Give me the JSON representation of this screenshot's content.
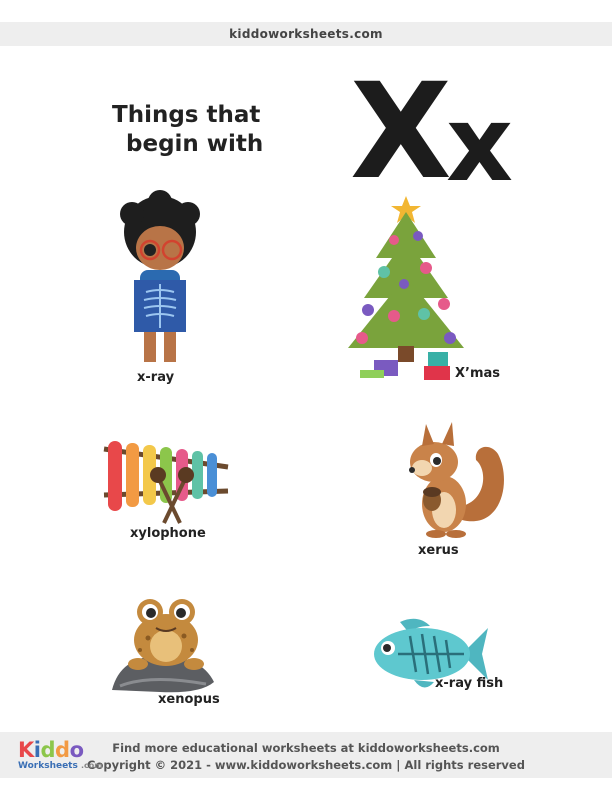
{
  "header": {
    "site": "kiddoworksheets.com"
  },
  "title": {
    "line1": "Things that",
    "line2": "begin with",
    "upper": "X",
    "lower": "x"
  },
  "items": [
    {
      "label": "x-ray",
      "icon": "boy-holding-x-ray-icon"
    },
    {
      "label": "X’mas",
      "icon": "christmas-tree-icon"
    },
    {
      "label": "xylophone",
      "icon": "xylophone-icon"
    },
    {
      "label": "xerus",
      "icon": "squirrel-icon"
    },
    {
      "label": "xenopus",
      "icon": "frog-icon"
    },
    {
      "label": "x-ray fish",
      "icon": "fish-icon"
    }
  ],
  "footer": {
    "logo_word": "Kiddo",
    "logo_sub": "Worksheets",
    "logo_com": ".com",
    "line1": "Find more educational worksheets at kiddoworksheets.com",
    "line2": "Copyright © 2021 - www.kiddoworksheets.com  |  All rights reserved"
  },
  "colors": {
    "bars": "#eeeeee",
    "text": "#222222",
    "logo_blue": "#3a6fb5"
  }
}
